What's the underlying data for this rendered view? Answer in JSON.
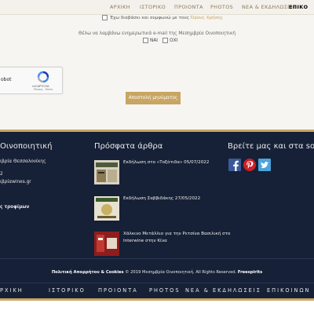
{
  "nav": {
    "items": [
      "ΑΡΧΙΚΗ",
      "ΙΣΤΟΡΙΚΟ",
      "ΠΡΟΙΟΝΤΑ",
      "PHOTOS",
      "ΝΕΑ & ΕΚΔΗΛΩΣΕΙΣ",
      "ΕΠΙΚΟ"
    ],
    "active_index": 5
  },
  "form": {
    "consent_text": "Έχω διαβάσει και συμφωνώ με τους",
    "consent_link": "Όρους Χρήσης",
    "newsletter_question": "Θέλω να λαμβάνω ενημερωτικά e-mail της Μεσημβρία Οινοποιητική",
    "option_yes": "ΝΑΙ",
    "option_no": "ΟΧΙ",
    "captcha_label": "obot",
    "captcha_brand": "reCAPTCHA",
    "captcha_terms": "Privacy - Terms",
    "submit_label": "Αποστολή μηνύματος"
  },
  "footer": {
    "col1": {
      "title": "Οινοποιητική",
      "lines": [
        "ιβρία Θεσσαλονίκης",
        "2",
        "ιβρίαwines.gr"
      ],
      "extra": "ς τροφίμων"
    },
    "col2": {
      "title": "Πρόσφατα άρθρα",
      "articles": [
        {
          "title": "Εκδήλωση στο «Τοξότιδα» 05/07/2022"
        },
        {
          "title": "Εκδήλωση Σαββιδάκης 27/05/2022"
        },
        {
          "title": "Χάλκινο Μετάλλιο για την Ρετσίνα Βασιλική στο",
          "title2": "Interwine στην Κίνα"
        }
      ]
    },
    "col3": {
      "title": "Βρείτε μας και στα social"
    },
    "copyright_prefix": "Πολιτική Απορρήτου & Cookies",
    "copyright_middle": "© 2019 Μεσημβρία Οινοποιητική. All Rights Reserved.",
    "copyright_brand": "Freespirits"
  },
  "bottom_nav": {
    "items": [
      "ΡΧΙΚΗ",
      "ΙΣΤΟΡΙΚΟ",
      "ΠΡΟΙΟΝΤΑ",
      "PHOTOS",
      "ΝΕΑ & ΕΚΔΗΛΩΣΕΙΣ",
      "ΕΠΙΚΟΙΝΩΝ"
    ]
  },
  "colors": {
    "footer_bg": "#162036",
    "accent_gold": "#c9a45f",
    "facebook": "#3b5998",
    "pinterest": "#cb2027",
    "twitter": "#4ba3dd"
  },
  "icons": [
    "recaptcha-logo-icon",
    "facebook-icon",
    "pinterest-icon",
    "twitter-icon"
  ]
}
